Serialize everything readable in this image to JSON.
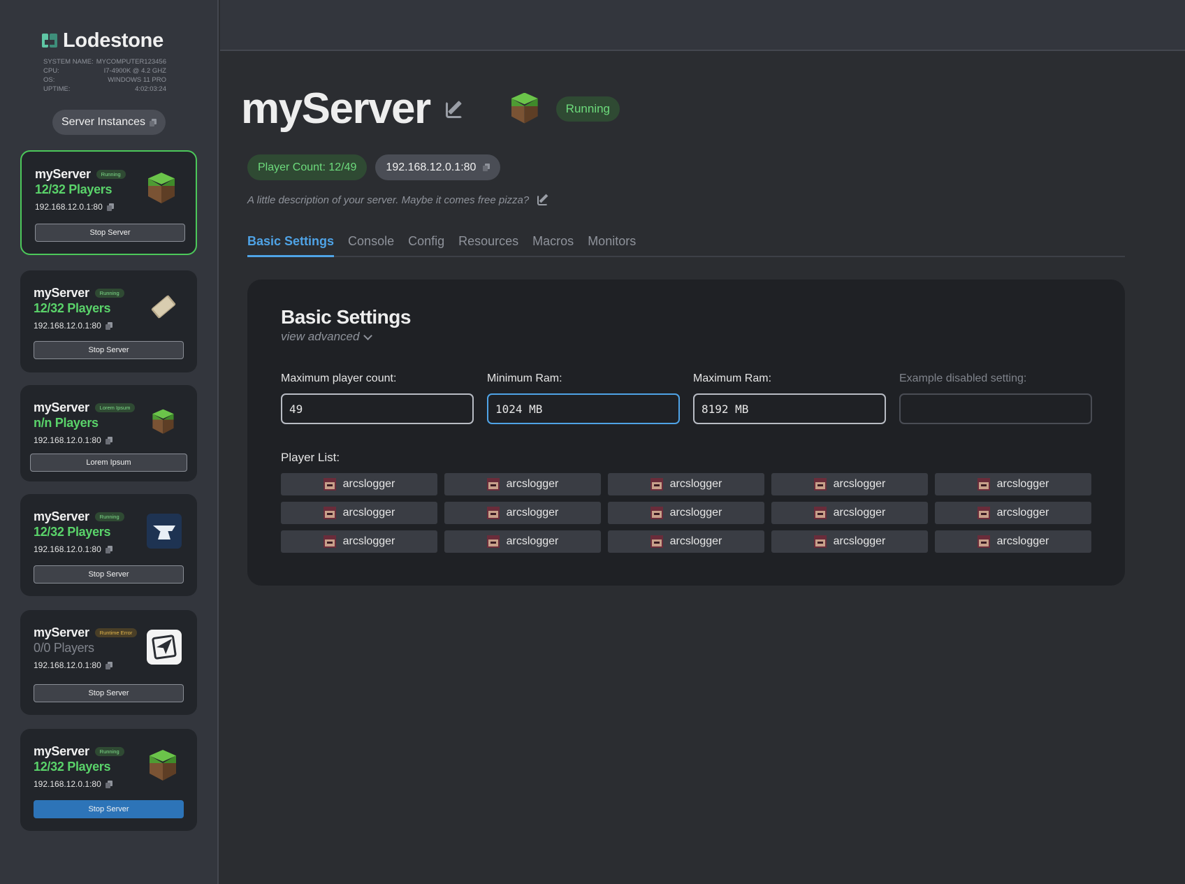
{
  "brand": {
    "name": "Lodestone"
  },
  "system_info": [
    {
      "label": "SYSTEM NAME:",
      "value": "MYCOMPUTER123456"
    },
    {
      "label": "CPU:",
      "value": "I7-4900K @ 4.2 GHZ"
    },
    {
      "label": "OS:",
      "value": "WINDOWS 11 PRO"
    },
    {
      "label": "UPTIME:",
      "value": "4:02:03:24"
    }
  ],
  "sidebar": {
    "instances_label": "Server Instances",
    "cards": [
      {
        "name": "myServer",
        "status": "Running",
        "players": "12/32 Players",
        "ip": "192.168.12.0.1:80",
        "button": "Stop Server",
        "icon": "grass-block-icon"
      },
      {
        "name": "myServer",
        "status": "Running",
        "players": "12/32 Players",
        "ip": "192.168.12.0.1:80",
        "button": "Stop Server",
        "icon": "paper-scroll-icon"
      },
      {
        "name": "myServer",
        "status": "Lorem Ipsum",
        "players": "n/n Players",
        "ip": "192.168.12.0.1:80",
        "button": "Lorem Ipsum",
        "icon": "grass-block-icon"
      },
      {
        "name": "myServer",
        "status": "Running",
        "players": "12/32 Players",
        "ip": "192.168.12.0.1:80",
        "button": "Stop Server",
        "icon": "anvil-icon"
      },
      {
        "name": "myServer",
        "status": "Runtime Error",
        "players": "0/0 Players",
        "ip": "192.168.12.0.1:80",
        "button": "Stop Server",
        "icon": "send-icon"
      },
      {
        "name": "myServer",
        "status": "Running",
        "players": "12/32 Players",
        "ip": "192.168.12.0.1:80",
        "button": "Stop Server",
        "icon": "grass-block-icon"
      }
    ]
  },
  "server": {
    "name": "myServer",
    "status": "Running",
    "player_count": "Player Count: 12/49",
    "ip": "192.168.12.0.1:80",
    "description": "A little description of your server. Maybe it comes free pizza?"
  },
  "tabs": [
    "Basic Settings",
    "Console",
    "Config",
    "Resources",
    "Macros",
    "Monitors"
  ],
  "settings": {
    "title": "Basic Settings",
    "view_advanced": "view advanced",
    "fields": [
      {
        "label": "Maximum player count:",
        "value": "49"
      },
      {
        "label": "Minimum Ram:",
        "value": "1024 MB"
      },
      {
        "label": "Maximum Ram:",
        "value": "8192 MB"
      },
      {
        "label": "Example disabled setting:",
        "value": ""
      }
    ],
    "player_list_label": "Player List:",
    "players": [
      "arcslogger",
      "arcslogger",
      "arcslogger",
      "arcslogger",
      "arcslogger",
      "arcslogger",
      "arcslogger",
      "arcslogger",
      "arcslogger",
      "arcslogger",
      "arcslogger",
      "arcslogger",
      "arcslogger",
      "arcslogger",
      "arcslogger"
    ]
  },
  "colors": {
    "accent": "#4fa3e6",
    "running": "#5ad36a",
    "warning": "#e2b64c",
    "primary_button": "#2d74b8"
  }
}
